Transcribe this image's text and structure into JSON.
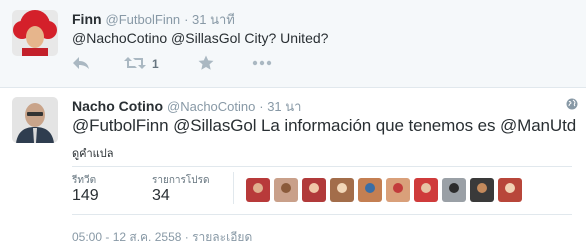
{
  "tweet1": {
    "name": "Finn",
    "handle": "@FutbolFinn",
    "time": "· 31 นาที",
    "text": "@NachoCotino @SillasGol City? United?",
    "retweet_count": "1",
    "icons": [
      "reply-icon",
      "retweet-icon",
      "favorite-icon",
      "more-icon"
    ]
  },
  "tweet2": {
    "name": "Nacho Cotino",
    "handle": "@NachoCotino",
    "time": "· 31 นา",
    "text": "@FutbolFinn @SillasGol La información que tenemos es @ManUtd",
    "translate": "ดูคำแปล",
    "retweets_label": "รีทวีต",
    "retweets_value": "149",
    "favorites_label": "รายการโปรด",
    "favorites_value": "34",
    "timestamp": "05:00 - 12 ส.ค. 2558 · รายละเอียด",
    "liker_colors": [
      "#b83a3a",
      "#c9a08a",
      "#b13a3a",
      "#a36d4a",
      "#c47f52",
      "#d9a07a",
      "#cf3b3b",
      "#9aa0a6",
      "#3a3a3a",
      "#b8463a",
      "#c23b3b"
    ]
  },
  "colors": {
    "accent": "#55acee",
    "muted": "#8899a6",
    "text": "#292f33",
    "bg_highlight": "#f5f8fa"
  }
}
